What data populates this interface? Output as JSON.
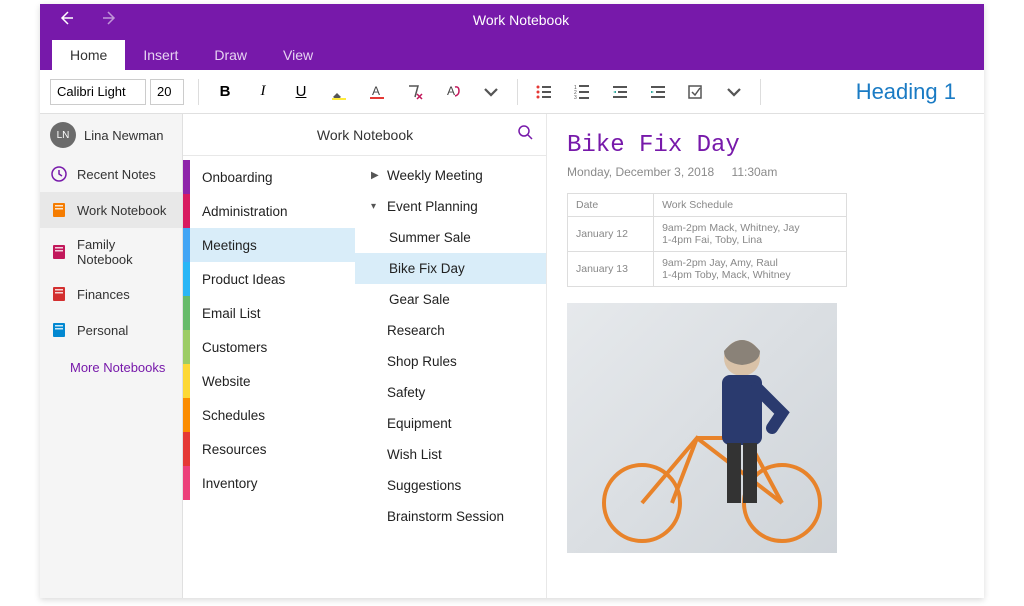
{
  "window": {
    "title": "Work Notebook"
  },
  "tabs": [
    {
      "label": "Home",
      "active": true
    },
    {
      "label": "Insert"
    },
    {
      "label": "Draw"
    },
    {
      "label": "View"
    }
  ],
  "ribbon": {
    "font_name": "Calibri Light",
    "font_size": "20",
    "heading_style": "Heading 1"
  },
  "user": {
    "initials": "LN",
    "name": "Lina Newman"
  },
  "sidebar": {
    "items": [
      {
        "label": "Recent Notes",
        "icon": "recent",
        "color": "#7719aa"
      },
      {
        "label": "Work Notebook",
        "icon": "notebook",
        "color": "#f57c00",
        "active": true
      },
      {
        "label": "Family Notebook",
        "icon": "notebook",
        "color": "#c2185b"
      },
      {
        "label": "Finances",
        "icon": "notebook",
        "color": "#d32f2f"
      },
      {
        "label": "Personal",
        "icon": "notebook",
        "color": "#0288d1"
      }
    ],
    "more_label": "More Notebooks"
  },
  "panel": {
    "title": "Work Notebook"
  },
  "sections": [
    {
      "label": "Onboarding",
      "color": "#8e24aa"
    },
    {
      "label": "Administration",
      "color": "#d81b60"
    },
    {
      "label": "Meetings",
      "color": "#42a5f5",
      "active": true
    },
    {
      "label": "Product Ideas",
      "color": "#29b6f6"
    },
    {
      "label": "Email List",
      "color": "#66bb6a"
    },
    {
      "label": "Customers",
      "color": "#9ccc65"
    },
    {
      "label": "Website",
      "color": "#fdd835"
    },
    {
      "label": "Schedules",
      "color": "#fb8c00"
    },
    {
      "label": "Resources",
      "color": "#e53935"
    },
    {
      "label": "Inventory",
      "color": "#ec407a"
    }
  ],
  "pages": [
    {
      "label": "Weekly Meeting",
      "chev": "right"
    },
    {
      "label": "Event Planning",
      "chev": "down"
    },
    {
      "label": "Summer Sale",
      "indent": true
    },
    {
      "label": "Bike Fix Day",
      "indent": true,
      "active": true
    },
    {
      "label": "Gear Sale",
      "indent": true
    },
    {
      "label": "Research"
    },
    {
      "label": "Shop Rules"
    },
    {
      "label": "Safety"
    },
    {
      "label": "Equipment"
    },
    {
      "label": "Wish List"
    },
    {
      "label": "Suggestions"
    },
    {
      "label": "Brainstorm Session"
    }
  ],
  "note": {
    "title": "Bike Fix Day",
    "date": "Monday, December 3, 2018",
    "time": "11:30am",
    "table": {
      "headers": [
        "Date",
        "Work Schedule"
      ],
      "rows": [
        [
          "January 12",
          "9am-2pm Mack, Whitney, Jay\n1-4pm Fai, Toby, Lina"
        ],
        [
          "January 13",
          "9am-2pm Jay, Amy, Raul\n1-4pm Toby, Mack, Whitney"
        ]
      ]
    }
  }
}
